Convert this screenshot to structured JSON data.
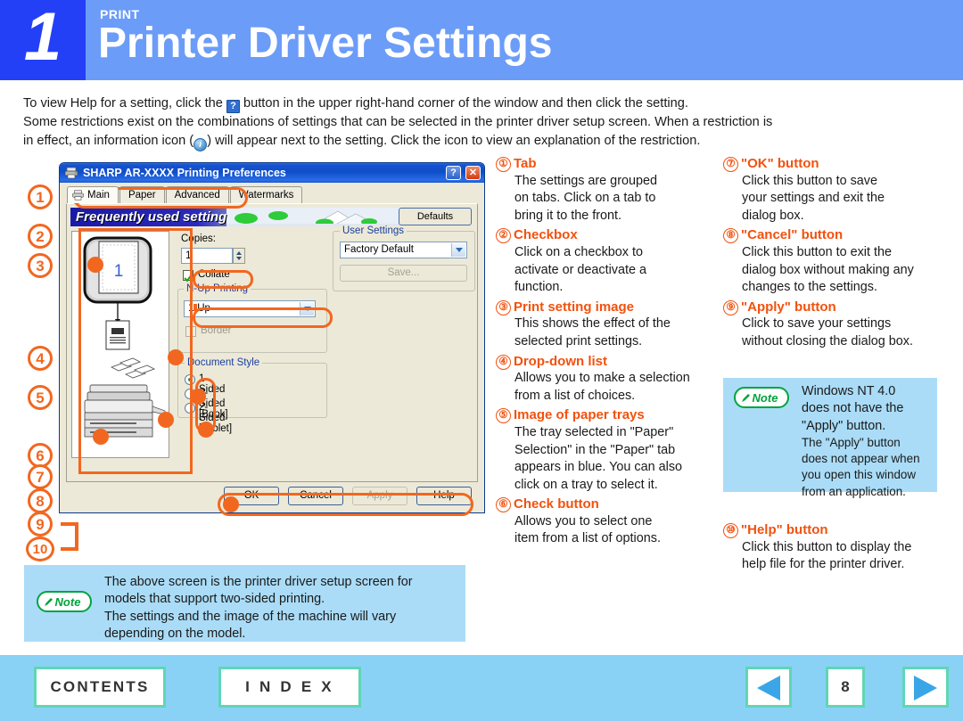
{
  "header": {
    "number": "1",
    "kicker": "PRINT",
    "title": "Printer Driver Settings"
  },
  "intro": {
    "line1a": "To view Help for a setting, click the",
    "help_icon_glyph": "?",
    "line1b": "button in the upper right-hand corner of the window and then click the setting.",
    "line2": "Some restrictions exist on the combinations of settings that can be selected in the printer driver setup screen. When a restriction is",
    "line3a": "in effect, an information icon (",
    "info_icon_glyph": "i",
    "line3b": ") will appear next to the setting. Click the icon to view an explanation of the restriction."
  },
  "dialog": {
    "title": "SHARP AR-XXXX Printing Preferences",
    "titlebar_help": "?",
    "titlebar_close": "✕",
    "tabs": [
      {
        "label": "Main",
        "active": true
      },
      {
        "label": "Paper",
        "active": false
      },
      {
        "label": "Advanced",
        "active": false
      },
      {
        "label": "Watermarks",
        "active": false
      }
    ],
    "banner_label": "Frequently used setting",
    "defaults_button": "Defaults",
    "preview_page_number": "1",
    "copies_label": "Copies:",
    "copies_value": "1",
    "collate_label": "Collate",
    "nup_legend": "N-Up Printing",
    "nup_value": "1-Up",
    "border_label": "Border",
    "user_settings_legend": "User Settings",
    "user_settings_value": "Factory Default",
    "save_button": "Save...",
    "document_style_legend": "Document Style",
    "document_style_options": [
      {
        "label": "1-Sided",
        "selected": true
      },
      {
        "label": "2-Sided [Book]",
        "selected": false
      },
      {
        "label": "2-Sided [Tablet]",
        "selected": false
      }
    ],
    "footer_buttons": [
      {
        "label": "OK",
        "disabled": false
      },
      {
        "label": "Cancel",
        "disabled": false
      },
      {
        "label": "Apply",
        "disabled": true
      },
      {
        "label": "Help",
        "disabled": false
      }
    ]
  },
  "callouts": [
    "1",
    "2",
    "3",
    "4",
    "5",
    "6",
    "7",
    "8",
    "9",
    "10"
  ],
  "items": [
    {
      "num": "①",
      "title": "Tab",
      "body": [
        "The settings are grouped",
        "on tabs. Click on a tab to",
        "bring it to the front."
      ]
    },
    {
      "num": "②",
      "title": "Checkbox",
      "body": [
        "Click on a checkbox to",
        "activate or deactivate a",
        "function."
      ]
    },
    {
      "num": "③",
      "title": "Print setting image",
      "body": [
        "This shows the effect of the",
        "selected print settings."
      ]
    },
    {
      "num": "④",
      "title": "Drop-down list",
      "body": [
        "Allows you to make a selection",
        "from a list of choices."
      ]
    },
    {
      "num": "⑤",
      "title": "Image of paper trays",
      "body": [
        "The tray selected in \"Paper\"",
        "Selection\" in the \"Paper\" tab",
        "appears in blue. You can also",
        "click on a tray to select it."
      ]
    },
    {
      "num": "⑥",
      "title": "Check button",
      "body": [
        "Allows you to select one",
        "item from a list of options."
      ]
    },
    {
      "num": "⑦",
      "title": "\"OK\" button",
      "body": [
        "Click this button to save",
        "your settings and exit the",
        "dialog box."
      ]
    },
    {
      "num": "⑧",
      "title": "\"Cancel\" button",
      "body": [
        "Click this button to exit the",
        "dialog box without making any",
        "changes to the settings."
      ]
    },
    {
      "num": "⑨",
      "title": "\"Apply\" button",
      "body": [
        "Click to save your settings",
        "without closing the dialog box."
      ]
    },
    {
      "num": "⑩",
      "title": "\"Help\" button",
      "body": [
        "Click this button to display the",
        "help file for the printer driver."
      ]
    }
  ],
  "note_right": {
    "badge": "Note",
    "lines": [
      "Windows NT 4.0",
      "does not have the",
      "\"Apply\" button."
    ],
    "lines_small": [
      "The \"Apply\" button",
      "does not appear when",
      "you open this window",
      "from an application."
    ]
  },
  "note_bottom": {
    "badge": "Note",
    "lines": [
      "The above screen is the printer driver setup screen for",
      "models that support two-sided printing.",
      "The settings and the image of the machine will vary",
      "depending on the model."
    ]
  },
  "footer": {
    "contents": "CONTENTS",
    "index": "I N D E X",
    "page": "8",
    "prev_icon": "prev-arrow-icon",
    "next_icon": "next-arrow-icon"
  },
  "colors": {
    "header_block": "#2340f7",
    "header_banner": "#6b9cf8",
    "callout_orange": "#f2671f",
    "heading_orange": "#f2510e",
    "note_bg": "#aadcf7",
    "note_green": "#00a33c",
    "footer_bg": "#8ad2f5",
    "nav_border": "#5fd6b4"
  }
}
